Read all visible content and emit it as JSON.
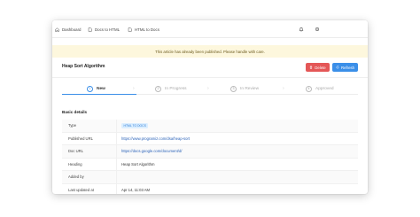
{
  "nav": {
    "items": [
      {
        "label": "Dashboard",
        "icon": "home-icon"
      },
      {
        "label": "Docs to HTML",
        "icon": "document-icon"
      },
      {
        "label": "HTML to Docs",
        "icon": "document-icon"
      }
    ],
    "right_icons": [
      "bell-icon",
      "gear-icon"
    ]
  },
  "banner": {
    "text": "This article has already been published. Please handle with care."
  },
  "header": {
    "title": "Heap Sort Algorithm",
    "delete_label": "Delete",
    "refresh_label": "Refresh",
    "delete_color": "#e45757",
    "refresh_color": "#3b8fe8"
  },
  "stepper": {
    "steps": [
      {
        "number": "1",
        "label": "New",
        "active": true
      },
      {
        "number": "2",
        "label": "In Progress",
        "active": false
      },
      {
        "number": "3",
        "label": "In Review",
        "active": false
      },
      {
        "number": "4",
        "label": "Approved",
        "active": false
      }
    ],
    "progress_fraction": 0.25
  },
  "details": {
    "section_title": "Basic details",
    "rows": [
      {
        "label": "Type",
        "value": "HTML TO DOCS",
        "kind": "tag"
      },
      {
        "label": "Published URL",
        "value": "https://www.programiz.com/dsa/heap-sort",
        "kind": "link"
      },
      {
        "label": "Doc URL",
        "value": "https://docs.google.com/document/d/",
        "kind": "link"
      },
      {
        "label": "Heading",
        "value": "Heap Sort Algorithm",
        "kind": "text"
      },
      {
        "label": "Added by",
        "value": "",
        "kind": "text"
      },
      {
        "label": "Last updated at",
        "value": "Apr 14, 11:03 AM",
        "kind": "text"
      }
    ]
  }
}
